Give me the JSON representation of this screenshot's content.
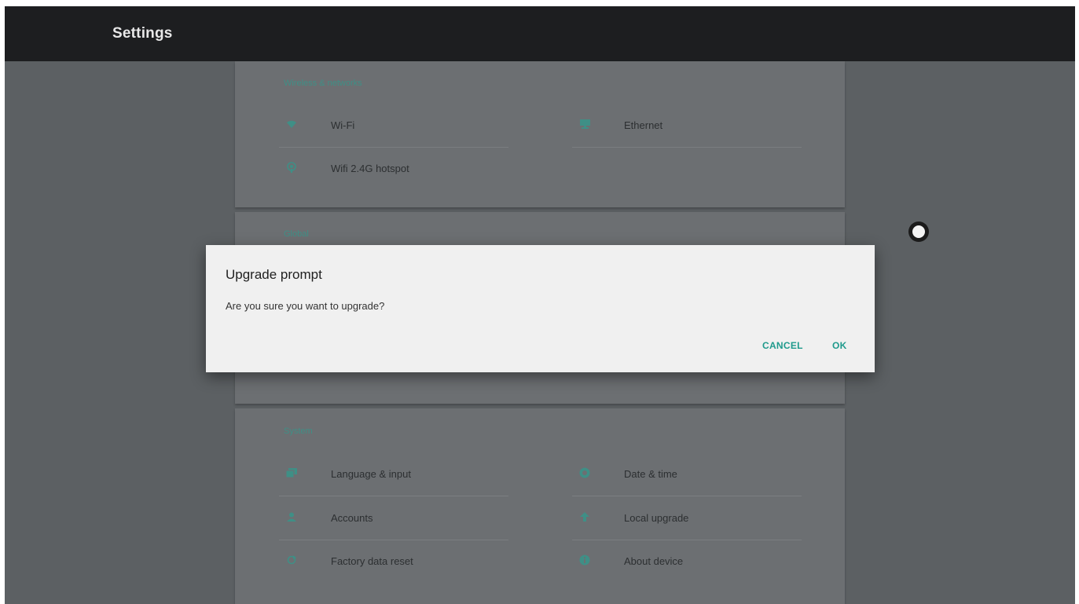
{
  "appbar": {
    "title": "Settings"
  },
  "sections": {
    "wireless": {
      "header": "Wireless & networks",
      "items": [
        {
          "label": "Wi-Fi",
          "icon": "wifi-icon"
        },
        {
          "label": "Ethernet",
          "icon": "ethernet-icon"
        },
        {
          "label": "Wifi 2.4G hotspot",
          "icon": "hotspot-icon"
        }
      ]
    },
    "global": {
      "header": "Global"
    },
    "system": {
      "header": "System",
      "items": [
        {
          "label": "Language & input",
          "icon": "keyboard-icon"
        },
        {
          "label": "Date & time",
          "icon": "clock-icon"
        },
        {
          "label": "Accounts",
          "icon": "person-icon"
        },
        {
          "label": "Local upgrade",
          "icon": "upload-arrow-icon"
        },
        {
          "label": "Factory data reset",
          "icon": "reset-icon"
        },
        {
          "label": "About device",
          "icon": "info-icon"
        }
      ]
    }
  },
  "dialog": {
    "title": "Upgrade prompt",
    "message": "Are you sure you want to upgrade?",
    "cancel_label": "CANCEL",
    "ok_label": "OK"
  },
  "colors": {
    "accent": "#1f9a8c",
    "appbar": "#1d1e20",
    "dim_background": "#5c6063",
    "dialog_background": "#f0f0f0"
  }
}
